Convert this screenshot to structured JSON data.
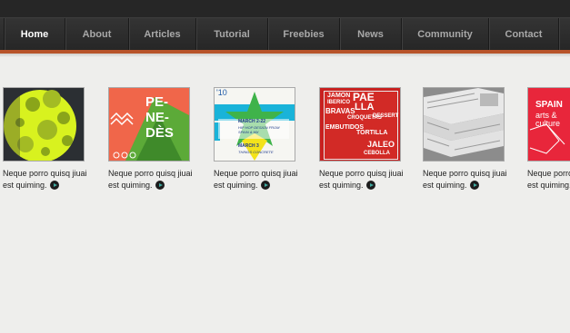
{
  "nav": {
    "items": [
      {
        "label": "Home",
        "active": true
      },
      {
        "label": "About",
        "active": false
      },
      {
        "label": "Articles",
        "active": false
      },
      {
        "label": "Tutorial",
        "active": false
      },
      {
        "label": "Freebies",
        "active": false
      },
      {
        "label": "News",
        "active": false
      },
      {
        "label": "Community",
        "active": false
      },
      {
        "label": "Contact",
        "active": false
      }
    ]
  },
  "colors": {
    "accent": "#b8542a",
    "nav_bg": "#2c2c2c",
    "page_bg": "#eeeeec",
    "arrow": "#3fa9a0"
  },
  "gallery": {
    "items": [
      {
        "caption_line1": "Neque porro quisq jiuai",
        "caption_line2": "est quiming.",
        "thumb_text": {}
      },
      {
        "caption_line1": "Neque porro quisq jiuai",
        "caption_line2": "est quiming.",
        "thumb_text": {
          "big": "PE- NE- DÈS"
        }
      },
      {
        "caption_line1": "Neque porro quisq jiuai",
        "caption_line2": "est quiming.",
        "thumb_text": {
          "corner": "'10",
          "date1": "MARCH 2-22",
          "line1": "HIP HOP DESIGN FROM",
          "line2": "SPAIN & MX",
          "date2": "MARCH 3",
          "line3": "THINGS CONCRETE"
        }
      },
      {
        "caption_line1": "Neque porro quisq jiuai",
        "caption_line2": "est quiming.",
        "thumb_text": {
          "w1": "JAMON",
          "w2": "PAE",
          "w3": "IBERICO",
          "w4": "LLA",
          "w5": "BRAVAS",
          "w6": "CROQUETAS",
          "w7": "EMBUTIDOS",
          "w8": "TORTILLA",
          "w9": "DESSERT",
          "w10": "JALEO",
          "w11": "CEBOLLA"
        }
      },
      {
        "caption_line1": "Neque porro quisq jiuai",
        "caption_line2": "est quiming.",
        "thumb_text": {}
      },
      {
        "caption_line1": "Neque porro quisq jiuai",
        "caption_line2": "est quiming.",
        "thumb_text": {
          "t1": "SPAIN",
          "t2": "arts &",
          "t3": "culture"
        }
      }
    ]
  }
}
